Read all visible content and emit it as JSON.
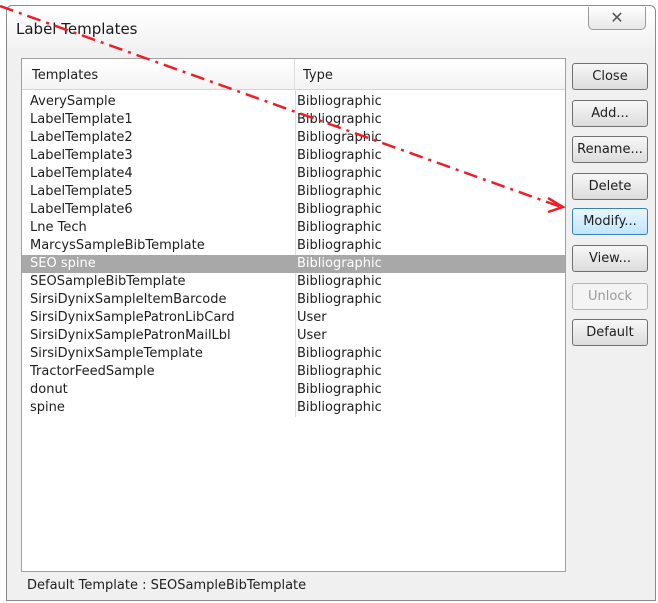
{
  "window": {
    "title": "Label Templates",
    "close_glyph": "✕"
  },
  "list": {
    "headers": {
      "templates": "Templates",
      "type": "Type"
    },
    "rows": [
      {
        "name": "AverySample",
        "type": "Bibliographic"
      },
      {
        "name": "LabelTemplate1",
        "type": "Bibliographic"
      },
      {
        "name": "LabelTemplate2",
        "type": "Bibliographic"
      },
      {
        "name": "LabelTemplate3",
        "type": "Bibliographic"
      },
      {
        "name": "LabelTemplate4",
        "type": "Bibliographic"
      },
      {
        "name": "LabelTemplate5",
        "type": "Bibliographic"
      },
      {
        "name": "LabelTemplate6",
        "type": "Bibliographic"
      },
      {
        "name": "Lne Tech",
        "type": "Bibliographic"
      },
      {
        "name": "MarcysSampleBibTemplate",
        "type": "Bibliographic"
      },
      {
        "name": "SEO spine",
        "type": "Bibliographic",
        "selected": true
      },
      {
        "name": "SEOSampleBibTemplate",
        "type": "Bibliographic"
      },
      {
        "name": "SirsiDynixSampleItemBarcode",
        "type": "Bibliographic"
      },
      {
        "name": "SirsiDynixSamplePatronLibCard",
        "type": "User"
      },
      {
        "name": "SirsiDynixSamplePatronMailLbl",
        "type": "User"
      },
      {
        "name": "SirsiDynixSampleTemplate",
        "type": "Bibliographic"
      },
      {
        "name": "TractorFeedSample",
        "type": "Bibliographic"
      },
      {
        "name": "donut",
        "type": "Bibliographic"
      },
      {
        "name": "spine",
        "type": "Bibliographic"
      }
    ]
  },
  "buttons": {
    "close": "Close",
    "add": "Add...",
    "rename": "Rename...",
    "delete": "Delete",
    "modify": "Modify...",
    "view": "View...",
    "unlock": "Unlock",
    "default": "Default"
  },
  "status": {
    "default_template": "Default Template : SEOSampleBibTemplate"
  },
  "colors": {
    "selection": "#a8a8a8",
    "annotation_arrow": "#e8202a",
    "focus_border": "#3c7fb1"
  }
}
